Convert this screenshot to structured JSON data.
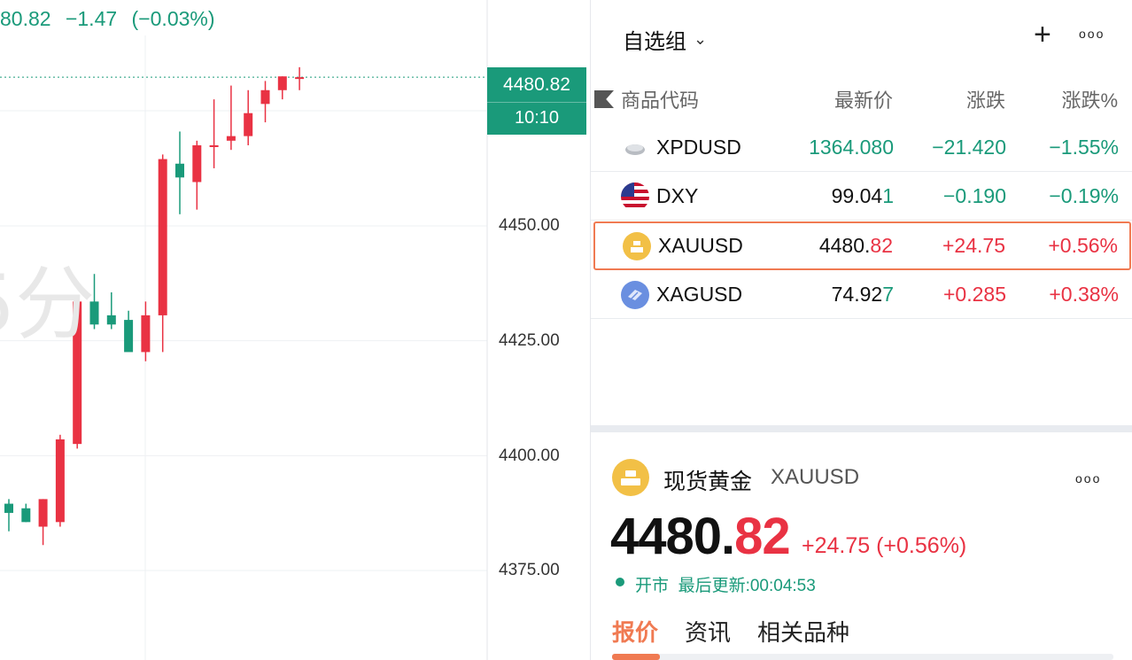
{
  "chart": {
    "ohlc_values": [
      "80.82",
      "−1.47",
      "(−0.03%)"
    ],
    "watermark": "5分",
    "last_price_tag": "4480.82",
    "countdown_tag": "10:10",
    "y_ticks": [
      "4450.00",
      "4425.00",
      "4400.00",
      "4375.00"
    ],
    "colors": {
      "up": "#e93243",
      "down": "#1a9a7a"
    },
    "candles": [
      {
        "o": 4388,
        "h": 4389,
        "l": 4382,
        "c": 4386
      },
      {
        "o": 4387,
        "h": 4388,
        "l": 4384,
        "c": 4384
      },
      {
        "o": 4383,
        "h": 4389,
        "l": 4379,
        "c": 4389
      },
      {
        "o": 4384,
        "h": 4403,
        "l": 4383,
        "c": 4402
      },
      {
        "o": 4401,
        "h": 4433,
        "l": 4400,
        "c": 4432
      },
      {
        "o": 4432,
        "h": 4438,
        "l": 4426,
        "c": 4427
      },
      {
        "o": 4429,
        "h": 4434,
        "l": 4426,
        "c": 4427
      },
      {
        "o": 4428,
        "h": 4430,
        "l": 4422,
        "c": 4421
      },
      {
        "o": 4421,
        "h": 4432,
        "l": 4419,
        "c": 4429
      },
      {
        "o": 4429,
        "h": 4464,
        "l": 4421,
        "c": 4463
      },
      {
        "o": 4462,
        "h": 4469,
        "l": 4451,
        "c": 4459
      },
      {
        "o": 4458,
        "h": 4467,
        "l": 4452,
        "c": 4466
      },
      {
        "o": 4466,
        "h": 4476,
        "l": 4461,
        "c": 4466
      },
      {
        "o": 4467,
        "h": 4479,
        "l": 4465,
        "c": 4468
      },
      {
        "o": 4468,
        "h": 4478,
        "l": 4466,
        "c": 4473
      },
      {
        "o": 4475,
        "h": 4480,
        "l": 4471,
        "c": 4478
      },
      {
        "o": 4478,
        "h": 4481,
        "l": 4476,
        "c": 4481
      },
      {
        "o": 4480.5,
        "h": 4483,
        "l": 4478,
        "c": 4480.82
      }
    ]
  },
  "watchlist": {
    "group_label": "自选组",
    "add_label": "+",
    "more_label": "ooo",
    "columns": {
      "symbol": "商品代码",
      "last": "最新价",
      "change": "涨跌",
      "change_pct": "涨跌%"
    },
    "rows": [
      {
        "symbol": "XPDUSD",
        "last_main": "1364.080",
        "last_tail": "",
        "change": "−21.420",
        "change_pct": "−1.55%",
        "direction": "down",
        "icon": "palladium-icon"
      },
      {
        "symbol": "DXY",
        "last_main": "99.04",
        "last_tail": "1",
        "change": "−0.190",
        "change_pct": "−0.19%",
        "direction": "down",
        "icon": "us-flag-icon"
      },
      {
        "symbol": "XAUUSD",
        "last_main": "4480.",
        "last_tail": "82",
        "change": "+24.75",
        "change_pct": "+0.56%",
        "direction": "up",
        "icon": "gold-icon"
      },
      {
        "symbol": "XAGUSD",
        "last_main": "74.92",
        "last_tail": "7",
        "change": "+0.285",
        "change_pct": "+0.38%",
        "direction": "up",
        "icon": "silver-icon"
      }
    ]
  },
  "detail": {
    "name": "现货黄金",
    "code": "XAUUSD",
    "more_label": "ooo",
    "price_main": "4480.",
    "price_tail": "82",
    "change": "+24.75 (+0.56%)",
    "market_status": "开市",
    "last_update": "最后更新:00:04:53",
    "tabs": [
      "报价",
      "资讯",
      "相关品种"
    ]
  }
}
